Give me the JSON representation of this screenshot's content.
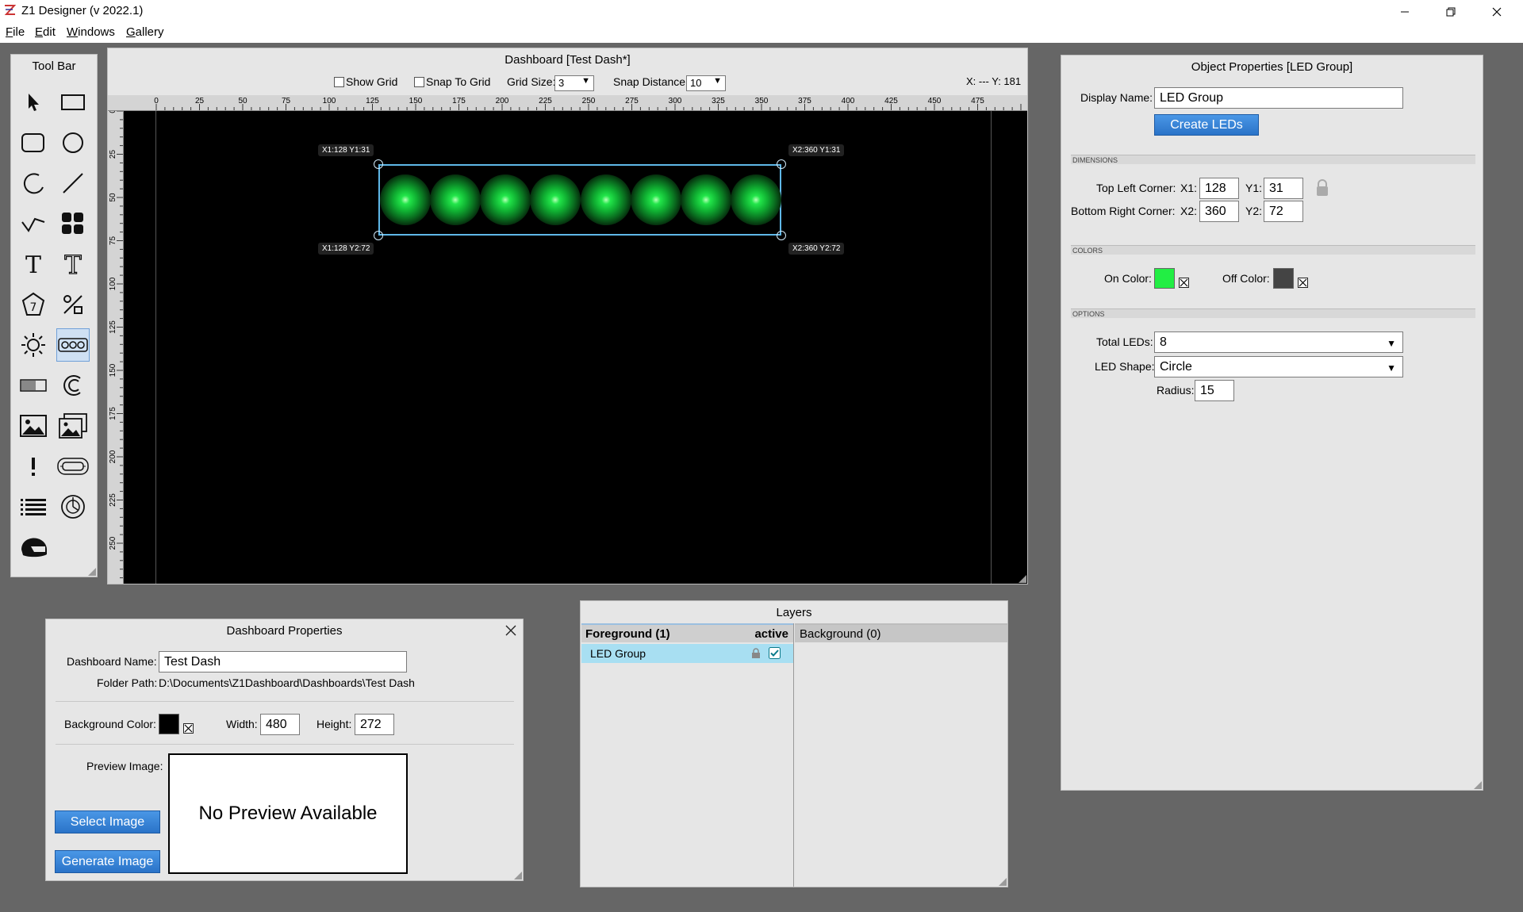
{
  "window": {
    "title": "Z1 Designer (v 2022.1)"
  },
  "menu": [
    {
      "label": "File",
      "accel": "F",
      "rest": "ile"
    },
    {
      "label": "Edit",
      "accel": "E",
      "rest": "dit"
    },
    {
      "label": "Windows",
      "accel": "W",
      "rest": "indows"
    },
    {
      "label": "Gallery",
      "accel": "G",
      "rest": "allery"
    }
  ],
  "toolbar": {
    "title": "Tool Bar",
    "tools": [
      "pointer-icon",
      "rectangle-icon",
      "rounded-rectangle-icon",
      "circle-icon",
      "arc-icon",
      "line-icon",
      "polyline-icon",
      "shapes-group-icon",
      "text-icon",
      "styled-text-icon",
      "seven-segment-icon",
      "percent-icon",
      "led-icon",
      "led-group-icon",
      "bar-gauge-icon",
      "arc-gauge-icon",
      "image-icon",
      "image-gallery-icon",
      "alert-icon",
      "indicator-icon",
      "list-icon",
      "dial-gauge-icon",
      "helmet-icon"
    ],
    "active": "led-group-icon"
  },
  "dashboard": {
    "title": "Dashboard [Test Dash*]",
    "show_grid": "Show Grid",
    "snap_to_grid": "Snap To Grid",
    "grid_size_label": "Grid Size:",
    "grid_size": "3",
    "snap_distance_label": "Snap Distance:",
    "snap_distance": "10",
    "cursor_readout": "X: --- Y: 181",
    "ruler_h": [
      "0",
      "25",
      "50",
      "75",
      "100",
      "125",
      "150",
      "175",
      "200",
      "225",
      "250",
      "275",
      "300",
      "325",
      "350",
      "375",
      "400",
      "425",
      "450",
      "475"
    ],
    "ruler_v": [
      "0",
      "25",
      "50",
      "75",
      "100",
      "125",
      "150",
      "175",
      "200",
      "225",
      "250"
    ],
    "tags": {
      "top_left": "X1:128 Y1:31",
      "top_right": "X2:360 Y1:31",
      "bottom_left": "X1:128 Y2:72",
      "bottom_right": "X2:360 Y2:72"
    },
    "led_count": 8,
    "led_color": "#22e64a"
  },
  "object_properties": {
    "title": "Object Properties [LED Group]",
    "display_name_label": "Display Name:",
    "display_name": "LED Group",
    "create_button": "Create LEDs",
    "dimensions_header": "DIMENSIONS",
    "top_left_label": "Top Left Corner:",
    "x1_label": "X1:",
    "x1": "128",
    "y1_label": "Y1:",
    "y1": "31",
    "bottom_right_label": "Bottom Right Corner:",
    "x2_label": "X2:",
    "x2": "360",
    "y2_label": "Y2:",
    "y2": "72",
    "colors_header": "COLORS",
    "on_color_label": "On Color:",
    "on_color": "#22ee44",
    "off_color_label": "Off Color:",
    "off_color": "#444444",
    "options_header": "OPTIONS",
    "total_leds_label": "Total LEDs:",
    "total_leds": "8",
    "led_shape_label": "LED Shape:",
    "led_shape": "Circle",
    "radius_label": "Radius:",
    "radius": "15"
  },
  "dashboard_properties": {
    "title": "Dashboard Properties",
    "name_label": "Dashboard Name:",
    "name": "Test Dash",
    "folder_label": "Folder Path:",
    "folder": "D:\\Documents\\Z1Dashboard\\Dashboards\\Test Dash",
    "bg_color_label": "Background Color:",
    "bg_color": "#000000",
    "width_label": "Width:",
    "width": "480",
    "height_label": "Height:",
    "height": "272",
    "preview_label": "Preview Image:",
    "preview_text": "No Preview Available",
    "select_button": "Select Image",
    "generate_button": "Generate Image"
  },
  "layers": {
    "title": "Layers",
    "foreground_header": "Foreground (1)",
    "active_label": "active",
    "background_header": "Background (0)",
    "items": [
      {
        "label": "LED Group",
        "checked": true
      }
    ]
  }
}
